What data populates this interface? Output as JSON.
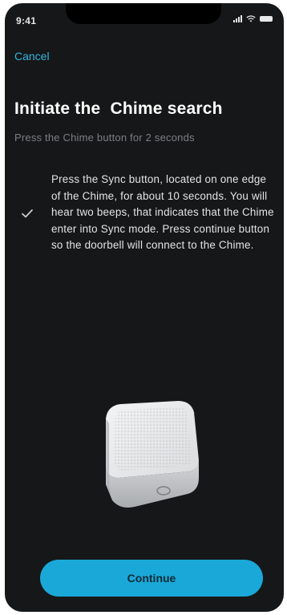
{
  "status_bar": {
    "time": "9:41"
  },
  "nav": {
    "cancel_label": "Cancel"
  },
  "header": {
    "title": "Initiate the  Chime search",
    "subtitle": "Press the Chime button for 2 seconds"
  },
  "instruction": {
    "checked": true,
    "text": "Press the Sync button, located on one edge of the Chime, for about 10 seconds. You will hear two beeps, that indicates that the Chime enter into Sync mode. Press continue button so the doorbell will connect to the Chime."
  },
  "footer": {
    "continue_label": "Continue"
  },
  "colors": {
    "background": "#161718",
    "accent": "#1aa8d8",
    "link": "#2fb7e0",
    "title": "#ffffff",
    "subtitle": "#7c7f83"
  },
  "icons": [
    "signal-icon",
    "wifi-icon",
    "battery-icon",
    "check-icon"
  ]
}
